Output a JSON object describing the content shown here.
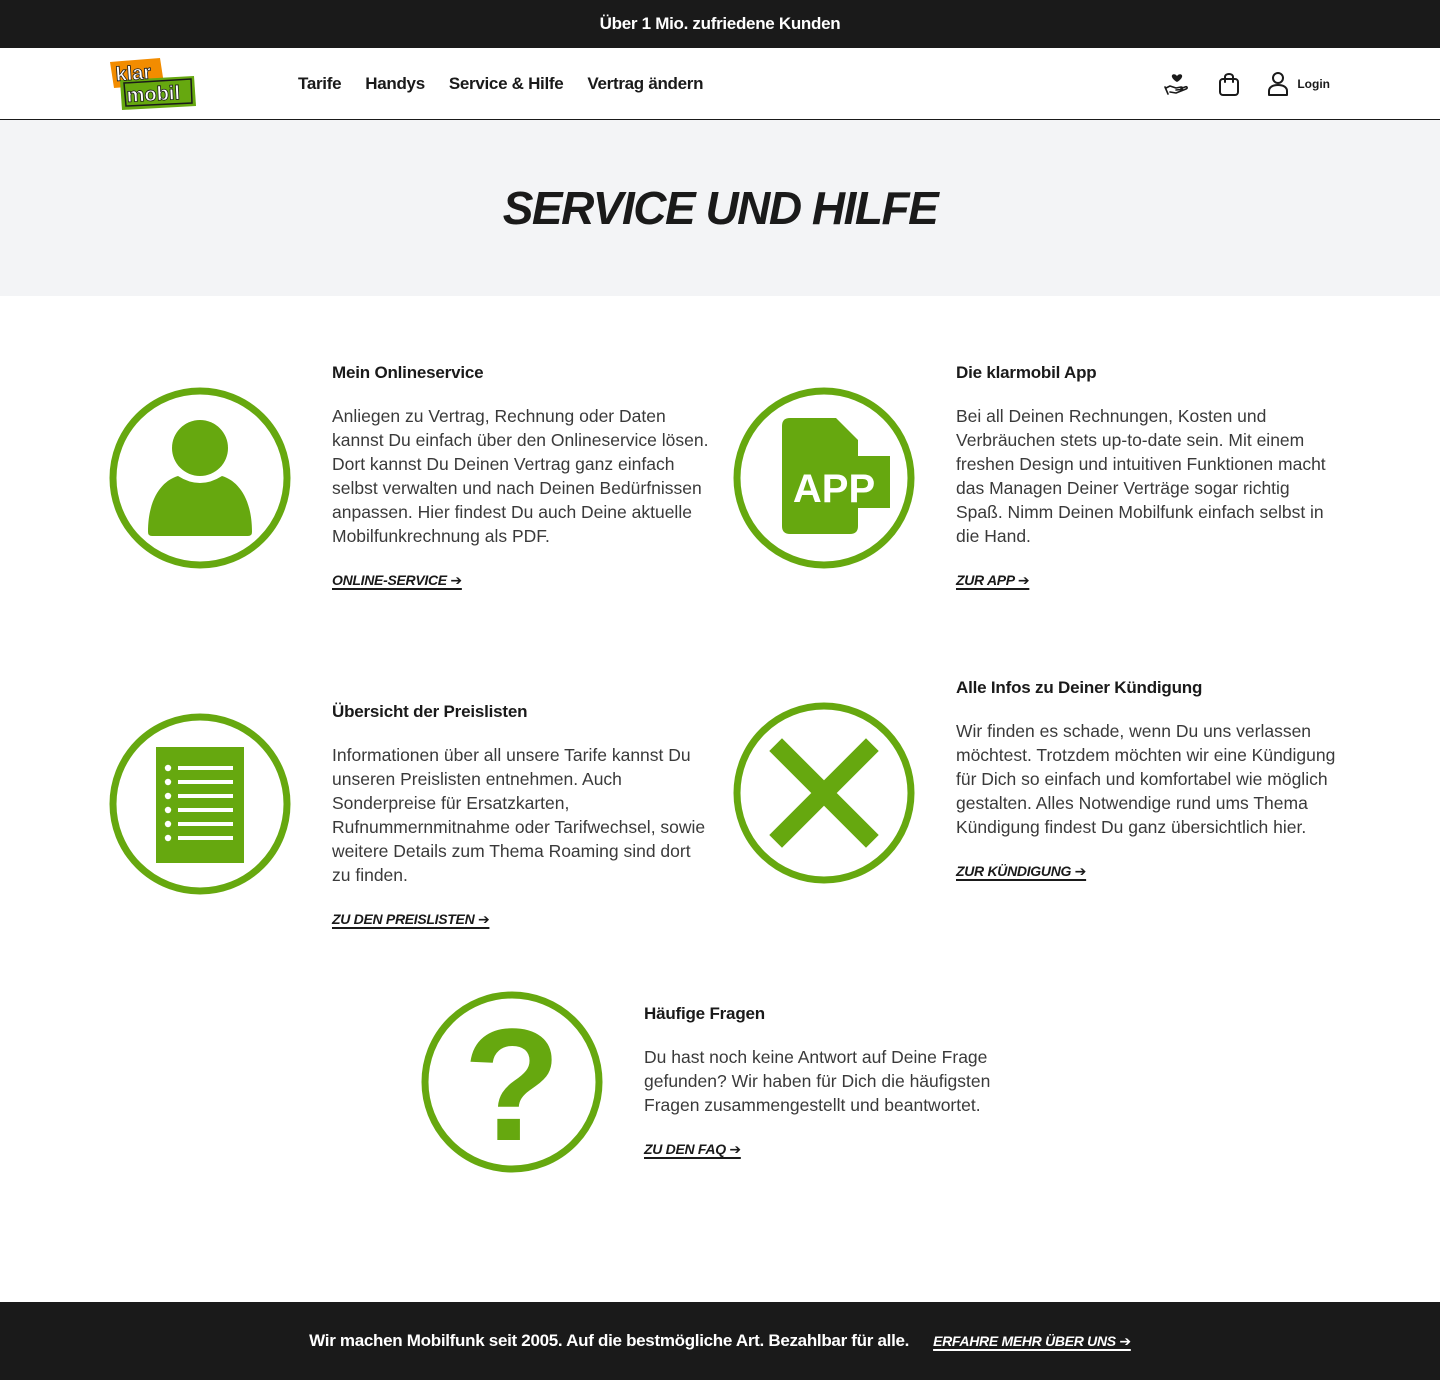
{
  "topbar": {
    "text": "Über 1 Mio. zufriedene Kunden"
  },
  "header": {
    "logo_line1": "klar",
    "logo_line2": "mobil",
    "nav": [
      "Tarife",
      "Handys",
      "Service & Hilfe",
      "Vertrag ändern"
    ],
    "login_label": "Login",
    "icons": [
      "heart-hand-icon",
      "shopping-bag-icon",
      "user-icon"
    ]
  },
  "hero": {
    "title": "SERVICE UND HILFE"
  },
  "cards": [
    {
      "title": "Mein Onlineservice",
      "text": "Anliegen zu Vertrag, Rechnung oder Daten kannst Du einfach über den Onlineservice lösen. Dort kannst Du Deinen Vertrag ganz einfach selbst verwalten und nach Deinen Bedürfnissen anpassen. Hier findest Du auch Deine aktuelle Mobilfunkrechnung als PDF.",
      "link": "ONLINE-SERVICE ➔",
      "icon": "user-icon"
    },
    {
      "title": "Die klarmobil App",
      "text": "Bei all Deinen Rechnungen, Kosten und Verbräuchen stets up-to-date sein. Mit einem freshen Design und intuitiven Funktionen macht das Managen Deiner Verträge sogar richtig Spaß. Nimm Deinen Mobilfunk einfach selbst in die Hand.",
      "link": "ZUR APP ➔",
      "icon": "app-icon",
      "icon_text": "APP"
    },
    {
      "title": "Übersicht der Preislisten",
      "text": "Informationen über all unsere Tarife kannst Du unseren Preislisten entnehmen. Auch Sonderpreise für Ersatzkarten, Rufnummernmitnahme oder Tarifwechsel, sowie weitere Details zum Thema Roaming sind dort zu finden.",
      "link": "ZU DEN PREISLISTEN ➔",
      "icon": "document-list-icon"
    },
    {
      "title": "Alle Infos zu Deiner Kündigung",
      "text": "Wir finden es schade, wenn Du uns verlassen möchtest. Trotzdem möchten wir eine Kündigung für Dich so einfach und komfortabel wie möglich gestalten. Alles Notwendige rund ums Thema Kündigung findest Du ganz übersichtlich hier.",
      "link": "ZUR KÜNDIGUNG ➔",
      "icon": "close-x-icon"
    },
    {
      "title": "Häufige Fragen",
      "text": "Du hast noch keine Antwort auf Deine Frage gefunden? Wir haben für Dich die häufigsten Fragen zusammengestellt und beantwortet.",
      "link": "ZU DEN FAQ ➔",
      "icon": "question-mark-icon",
      "icon_text": "?"
    }
  ],
  "footer": {
    "text": "Wir machen Mobilfunk seit 2005. Auf die bestmögliche Art. Bezahlbar für alle.",
    "link": "ERFAHRE MEHR ÜBER UNS ➔"
  },
  "colors": {
    "brand_green": "#66a80f",
    "brand_orange": "#f28c00",
    "dark": "#1a1a1a",
    "hero_bg": "#f3f4f6"
  }
}
